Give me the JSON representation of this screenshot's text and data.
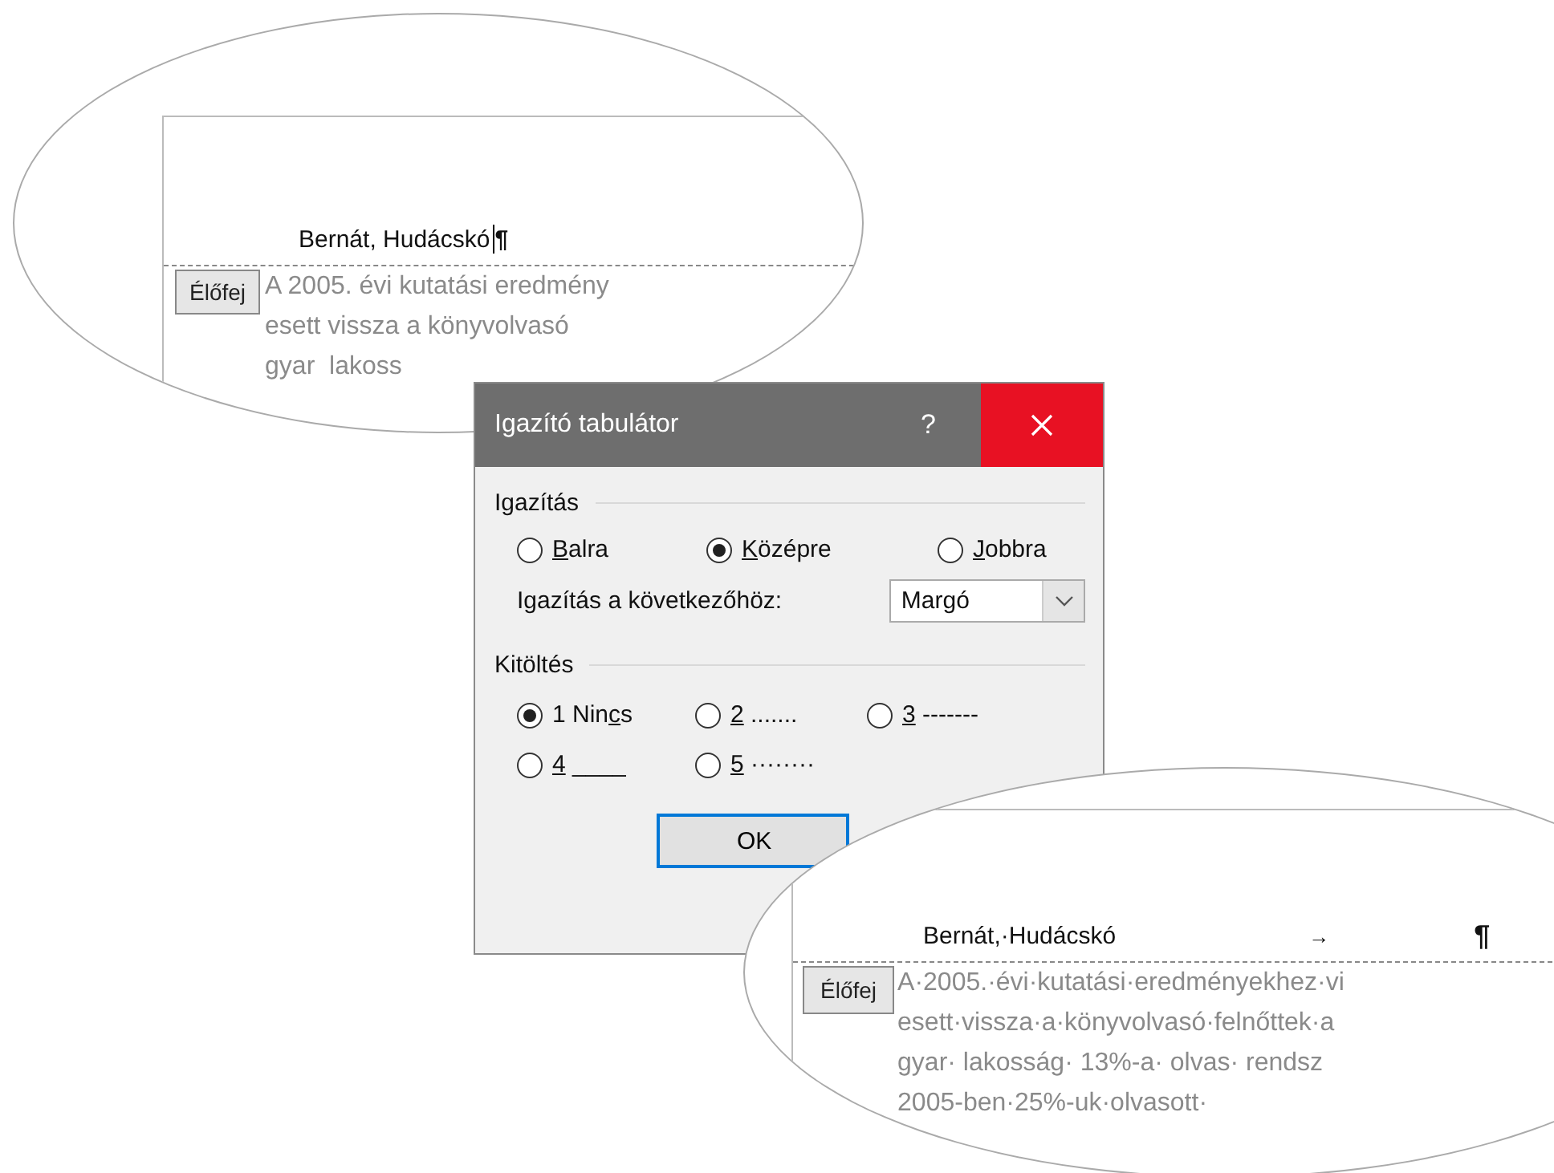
{
  "zoom_top": {
    "header_text": "Bernát, Hudácskó",
    "pilcrow": "¶",
    "header_tag": "Élőfej",
    "body_lines": [
      "A 2005. évi kutatási eredmény",
      "esett vissza a könyvolvasó",
      "gyar  lakoss"
    ]
  },
  "dialog": {
    "title": "Igazító tabulátor",
    "help": "?",
    "alignment": {
      "title": "Igazítás",
      "options": [
        {
          "key": "B",
          "post": "alra",
          "selected": false
        },
        {
          "key": "K",
          "post": "özépre",
          "selected": true
        },
        {
          "key": "J",
          "post": "obbra",
          "selected": false
        }
      ]
    },
    "align_to": {
      "label": "Igazítás a következőhöz:",
      "value": "Margó"
    },
    "leader": {
      "title": "Kitöltés",
      "options": [
        {
          "pre": "1 Nin",
          "key": "c",
          "post": "s",
          "selected": true
        },
        {
          "key": "2",
          "post": " .......",
          "selected": false
        },
        {
          "key": "3",
          "post": " -------",
          "selected": false
        },
        {
          "key": "4",
          "post": " ____",
          "selected": false
        },
        {
          "key": "5",
          "post": " ········",
          "selected": false
        }
      ]
    },
    "buttons": [
      "OK"
    ]
  },
  "zoom_bottom": {
    "header_text": "Bernát,·Hudácskó",
    "tab_mark": "→",
    "pilcrow": "¶",
    "header_tag": "Élőfej",
    "body_lines": [
      "A·2005.·évi·kutatási·eredményekhez·vi",
      "esett·vissza·a·könyvolvasó·felnőttek·a",
      "gyar· lakosság· 13%-a· olvas· rendsz",
      "2005-ben·25%-uk·olvasott·"
    ]
  }
}
